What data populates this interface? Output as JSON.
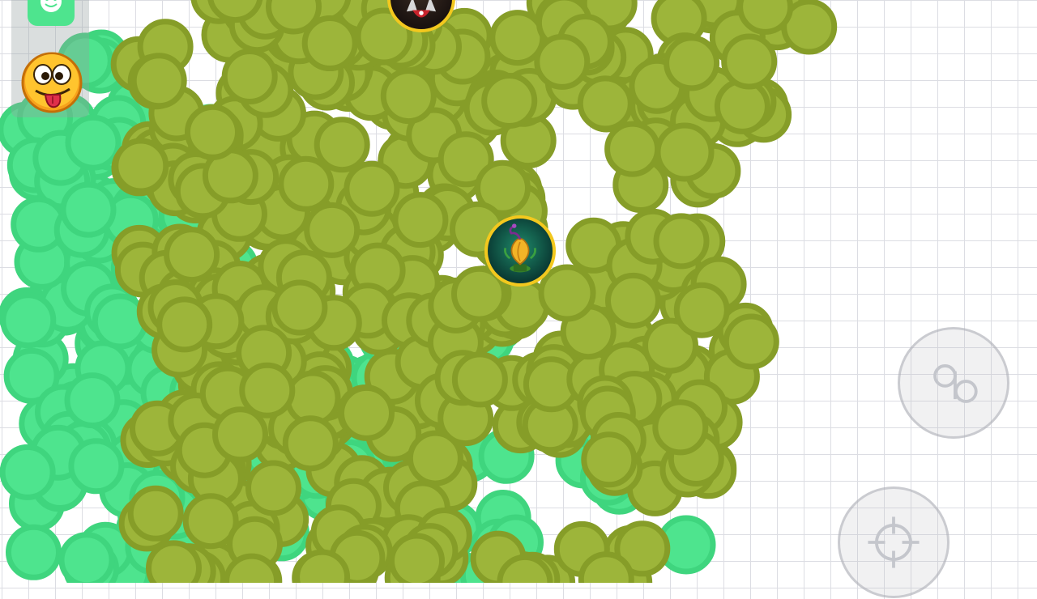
{
  "game": {
    "grid_color": "#dcdde3",
    "background_color": "#ffffff"
  },
  "player_cells": {
    "color": "#9db53a",
    "border_color": "#869d28"
  },
  "enemy_cells": {
    "color": "#4ee48e",
    "border_color": "#3fd57e"
  },
  "skins": [
    {
      "name": "dark-creature-skin",
      "border_color": "#f3c81e"
    },
    {
      "name": "plant-bulb-skin",
      "border_color": "#f3c81e"
    }
  ],
  "hud": {
    "emoji_icon": "tongue-out-emoji-icon",
    "top_icon": "smiley-icon"
  },
  "controls": {
    "split_icon": "split-icon",
    "eject_icon": "crosshair-icon"
  }
}
